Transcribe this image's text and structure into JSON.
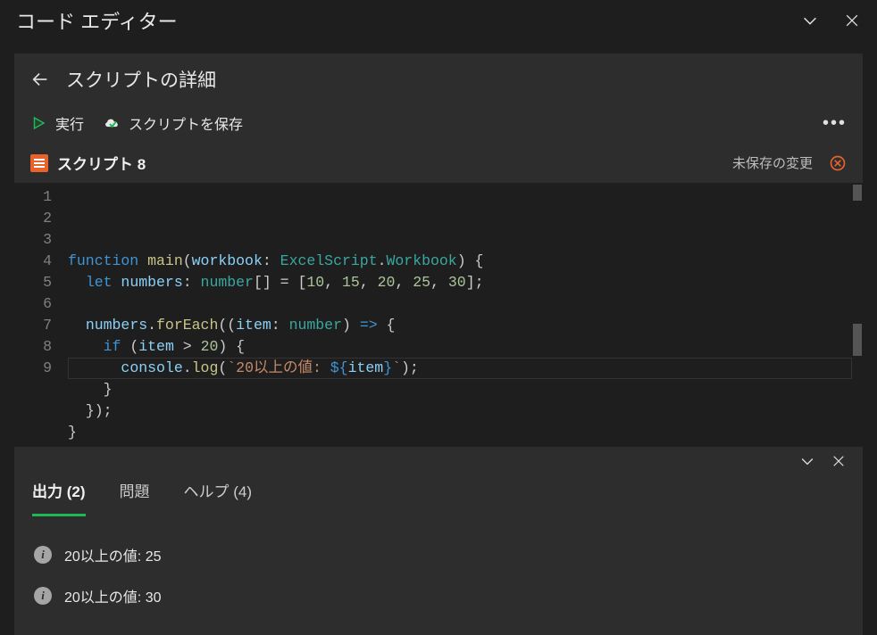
{
  "title_bar": {
    "title": "コード エディター"
  },
  "header": {
    "details_title": "スクリプトの詳細",
    "run_label": "実行",
    "save_label": "スクリプトを保存"
  },
  "script": {
    "name": "スクリプト 8",
    "unsaved_label": "未保存の変更"
  },
  "code": {
    "line_numbers": [
      "1",
      "2",
      "3",
      "4",
      "5",
      "6",
      "7",
      "8",
      "9"
    ],
    "tokens": [
      [
        {
          "t": "function ",
          "c": "hl-keyword"
        },
        {
          "t": "main",
          "c": "hl-func"
        },
        {
          "t": "(",
          "c": "hl-punct"
        },
        {
          "t": "workbook",
          "c": "hl-ident"
        },
        {
          "t": ": ",
          "c": "hl-punct"
        },
        {
          "t": "ExcelScript",
          "c": "hl-type"
        },
        {
          "t": ".",
          "c": "hl-punct"
        },
        {
          "t": "Workbook",
          "c": "hl-type"
        },
        {
          "t": ") {",
          "c": "hl-punct"
        }
      ],
      [
        {
          "t": "  ",
          "c": "hl-plain"
        },
        {
          "t": "let ",
          "c": "hl-keyword"
        },
        {
          "t": "numbers",
          "c": "hl-ident"
        },
        {
          "t": ": ",
          "c": "hl-punct"
        },
        {
          "t": "number",
          "c": "hl-type"
        },
        {
          "t": "[] = [",
          "c": "hl-punct"
        },
        {
          "t": "10",
          "c": "hl-number"
        },
        {
          "t": ", ",
          "c": "hl-punct"
        },
        {
          "t": "15",
          "c": "hl-number"
        },
        {
          "t": ", ",
          "c": "hl-punct"
        },
        {
          "t": "20",
          "c": "hl-number"
        },
        {
          "t": ", ",
          "c": "hl-punct"
        },
        {
          "t": "25",
          "c": "hl-number"
        },
        {
          "t": ", ",
          "c": "hl-punct"
        },
        {
          "t": "30",
          "c": "hl-number"
        },
        {
          "t": "];",
          "c": "hl-punct"
        }
      ],
      [],
      [
        {
          "t": "  ",
          "c": "hl-plain"
        },
        {
          "t": "numbers",
          "c": "hl-ident"
        },
        {
          "t": ".",
          "c": "hl-punct"
        },
        {
          "t": "forEach",
          "c": "hl-func"
        },
        {
          "t": "((",
          "c": "hl-punct"
        },
        {
          "t": "item",
          "c": "hl-ident"
        },
        {
          "t": ": ",
          "c": "hl-punct"
        },
        {
          "t": "number",
          "c": "hl-type"
        },
        {
          "t": ") ",
          "c": "hl-punct"
        },
        {
          "t": "=>",
          "c": "hl-keyword"
        },
        {
          "t": " {",
          "c": "hl-punct"
        }
      ],
      [
        {
          "t": "    ",
          "c": "hl-plain"
        },
        {
          "t": "if ",
          "c": "hl-keyword"
        },
        {
          "t": "(",
          "c": "hl-punct"
        },
        {
          "t": "item",
          "c": "hl-ident"
        },
        {
          "t": " > ",
          "c": "hl-punct"
        },
        {
          "t": "20",
          "c": "hl-number"
        },
        {
          "t": ") {",
          "c": "hl-punct"
        }
      ],
      [
        {
          "t": "      ",
          "c": "hl-plain"
        },
        {
          "t": "console",
          "c": "hl-ident"
        },
        {
          "t": ".",
          "c": "hl-punct"
        },
        {
          "t": "log",
          "c": "hl-func"
        },
        {
          "t": "(",
          "c": "hl-punct"
        },
        {
          "t": "`20以上の値: ",
          "c": "hl-string"
        },
        {
          "t": "${",
          "c": "hl-escape"
        },
        {
          "t": "item",
          "c": "hl-ident"
        },
        {
          "t": "}",
          "c": "hl-escape"
        },
        {
          "t": "`",
          "c": "hl-string"
        },
        {
          "t": ");",
          "c": "hl-punct"
        }
      ],
      [
        {
          "t": "    }",
          "c": "hl-punct"
        }
      ],
      [
        {
          "t": "  });",
          "c": "hl-punct"
        }
      ],
      [
        {
          "t": "}",
          "c": "hl-punct"
        }
      ]
    ],
    "cursor_line_index": 8
  },
  "bottom": {
    "tabs": [
      {
        "label": "出力 (2)",
        "active": true
      },
      {
        "label": "問題",
        "active": false
      },
      {
        "label": "ヘルプ (4)",
        "active": false
      }
    ],
    "output": [
      "20以上の値: 25",
      "20以上の値: 30"
    ]
  }
}
